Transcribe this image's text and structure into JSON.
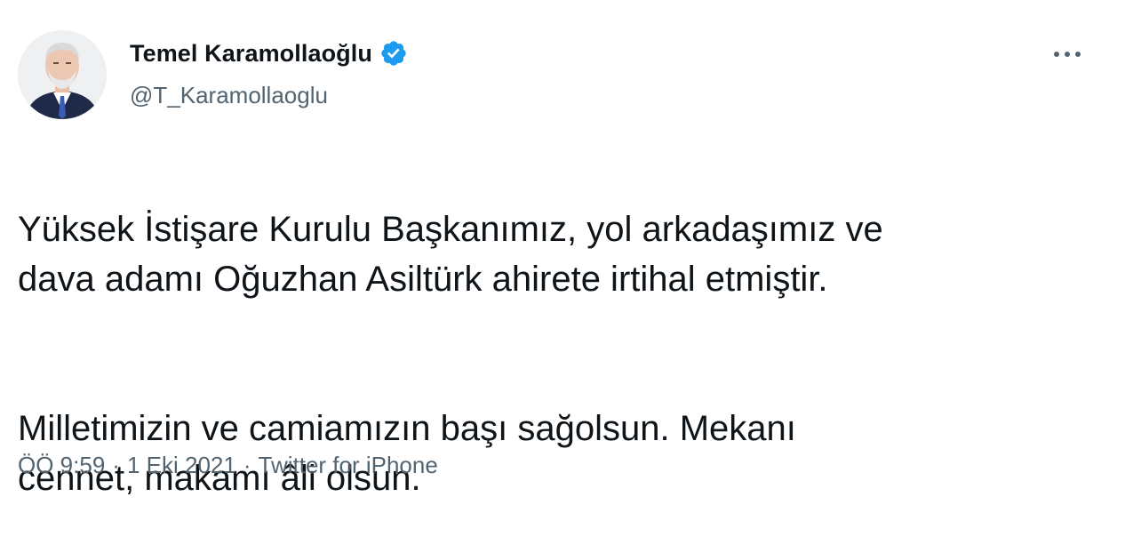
{
  "user": {
    "display_name": "Temel Karamollaoğlu",
    "handle": "@T_Karamollaoglu",
    "verified_icon": "verified-badge-icon",
    "accent_color": "#1d9bf0"
  },
  "menu": {
    "more_icon": "more-horizontal-icon"
  },
  "tweet": {
    "paragraph_1": "Yüksek İstişare Kurulu Başkanımız, yol arkadaşımız ve\ndava adamı Oğuzhan Asiltürk ahirete irtihal etmiştir.",
    "paragraph_2": "Milletimizin ve camiamızın başı sağolsun. Mekanı\ncennet, makamı âli olsun."
  },
  "meta": {
    "time": "ÖÖ 9:59",
    "separator": "·",
    "date": "1 Eki 2021",
    "source": "Twitter for iPhone"
  }
}
